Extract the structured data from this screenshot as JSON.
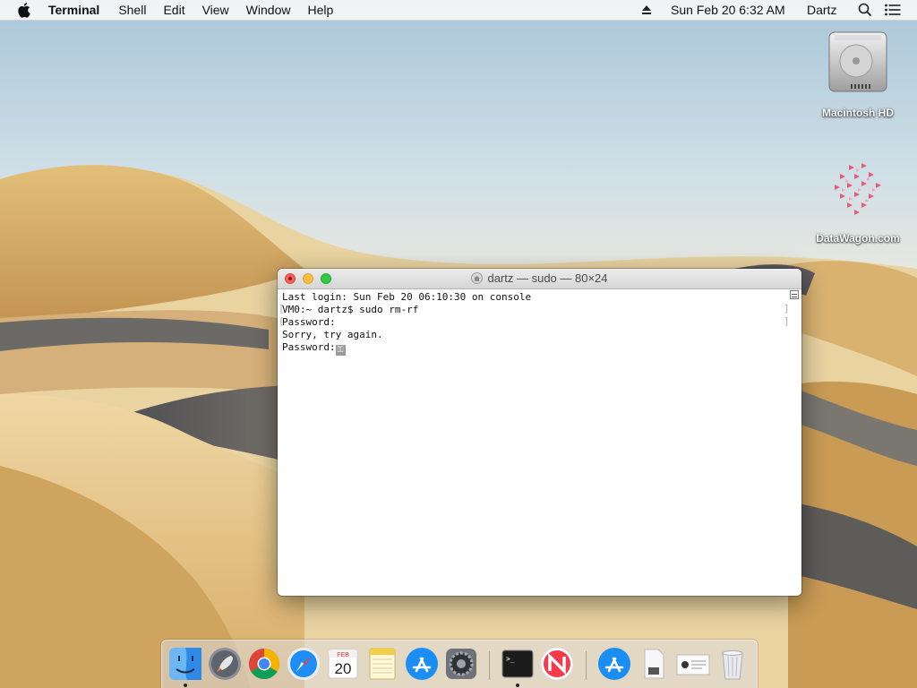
{
  "menubar": {
    "app_name": "Terminal",
    "menus": [
      "Shell",
      "Edit",
      "View",
      "Window",
      "Help"
    ],
    "clock": "Sun Feb 20  6:32 AM",
    "user": "Dartz"
  },
  "desktop_icons": [
    {
      "label": "Macintosh HD",
      "icon": "hard-drive-icon"
    },
    {
      "label": "DataWagon.com",
      "icon": "datawagon-disk-icon"
    }
  ],
  "terminal": {
    "title": "dartz — sudo — 80×24",
    "lines": [
      "Last login: Sun Feb 20 06:10:30 on console",
      "VM0:~ dartz$ sudo rm-rf",
      "Password:",
      "Sorry, try again.",
      "Password:"
    ]
  },
  "dock": {
    "items": [
      {
        "name": "finder-icon",
        "running": true
      },
      {
        "name": "launchpad-icon",
        "running": false
      },
      {
        "name": "chrome-icon",
        "running": false
      },
      {
        "name": "safari-icon",
        "running": false
      },
      {
        "name": "calendar-icon",
        "running": false,
        "month": "FEB",
        "day": "20"
      },
      {
        "name": "notes-icon",
        "running": false
      },
      {
        "name": "app-store-icon",
        "running": false
      },
      {
        "name": "system-preferences-icon",
        "running": false
      },
      {
        "name": "terminal-icon",
        "running": true
      },
      {
        "name": "news-icon",
        "running": false
      },
      {
        "name": "app-store-downloads-icon",
        "running": false
      },
      {
        "name": "document-icon",
        "running": false
      },
      {
        "name": "preview-icon",
        "running": false
      },
      {
        "name": "trash-icon",
        "running": false
      }
    ]
  },
  "colors": {
    "close": "#fc605b",
    "minimize": "#fdbc40",
    "maximize": "#34c84a"
  }
}
